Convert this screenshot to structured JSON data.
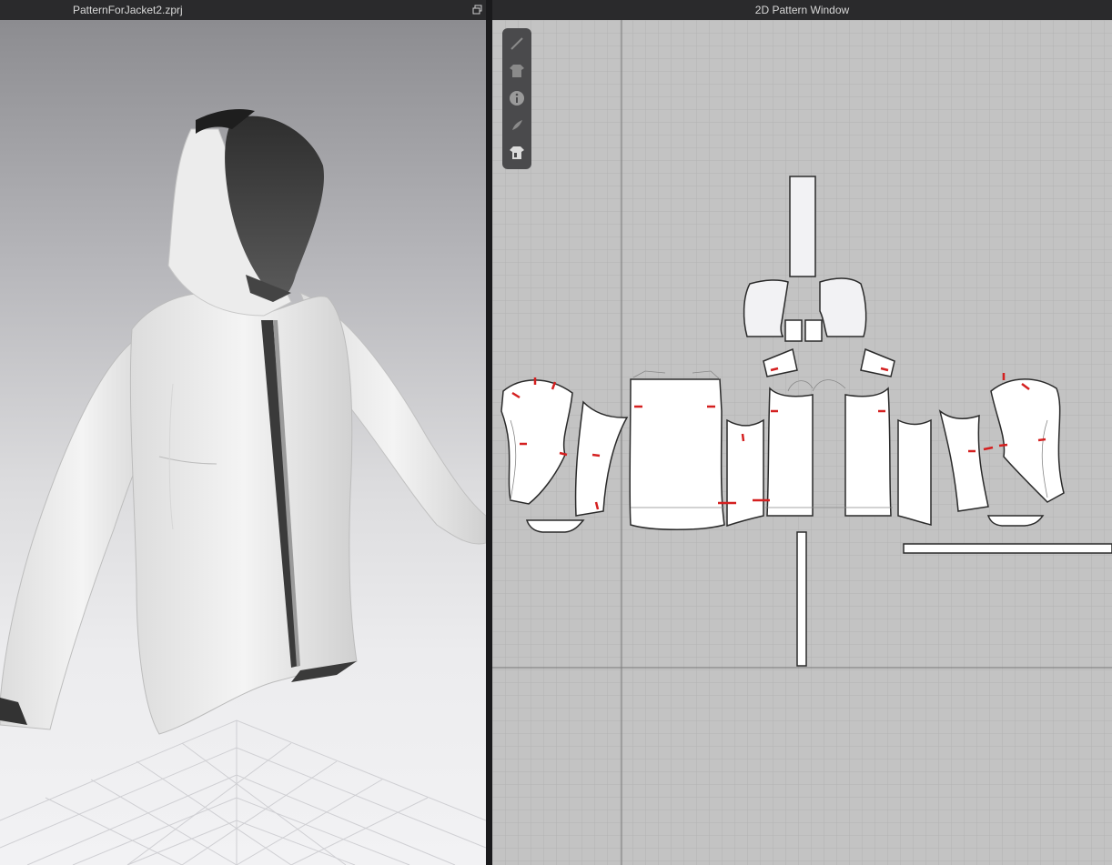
{
  "windows": {
    "viewport_3d": {
      "title": "PatternForJacket2.zprj"
    },
    "pattern_2d": {
      "title": "2D Pattern Window"
    }
  },
  "toolbox": [
    {
      "name": "seam-line-icon"
    },
    {
      "name": "garment-icon"
    },
    {
      "name": "info-icon"
    },
    {
      "name": "fabric-icon"
    },
    {
      "name": "avatar-garment-icon"
    }
  ],
  "colors": {
    "titlebar_bg": "#2a2a2c",
    "grid_bg": "#c3c3c3",
    "piece_fill": "#ffffff",
    "notch_red": "#d42020",
    "outline": "#2a2a2a"
  }
}
